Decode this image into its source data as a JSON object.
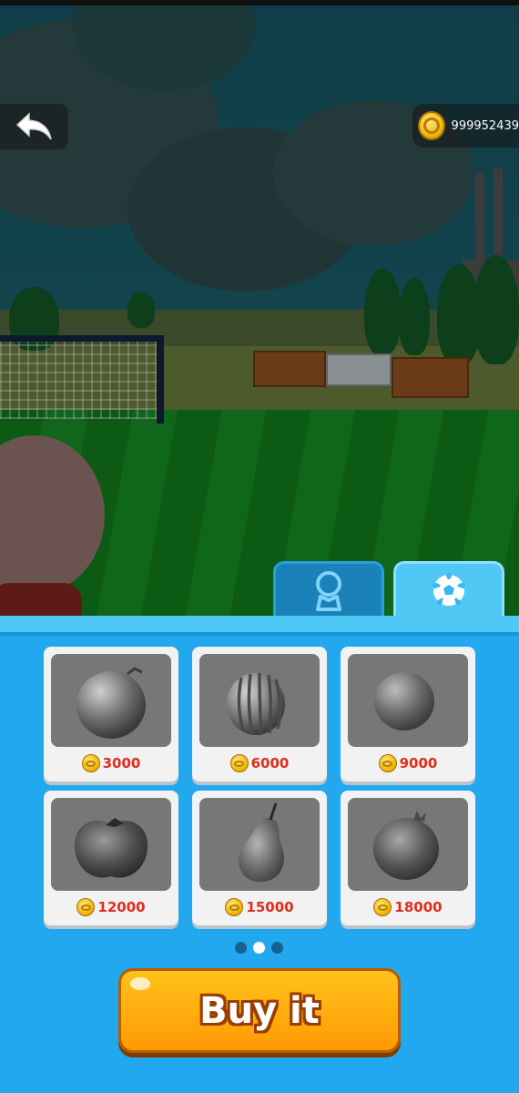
{
  "hud": {
    "coins": "999952439",
    "back_icon": "back-arrow-icon",
    "coin_icon": "gold-coin-icon"
  },
  "tabs": [
    {
      "icon": "character-skin-icon",
      "active": false
    },
    {
      "icon": "soccer-ball-icon",
      "active": true
    }
  ],
  "shop": {
    "items": [
      {
        "item": "orange-ball-icon",
        "price": "3000"
      },
      {
        "item": "watermelon-ball-icon",
        "price": "6000"
      },
      {
        "item": "round-fruit-ball-icon",
        "price": "9000"
      },
      {
        "item": "apple-ball-icon",
        "price": "12000"
      },
      {
        "item": "pear-ball-icon",
        "price": "15000"
      },
      {
        "item": "pomegranate-ball-icon",
        "price": "18000"
      }
    ],
    "pages": 3,
    "current_page": 2,
    "buy_label": "Buy it"
  },
  "colors": {
    "panel": "#21a8ee",
    "active_tab": "#4fc8f5",
    "price": "#e22b1b",
    "buy_button": "#ffb00f"
  }
}
